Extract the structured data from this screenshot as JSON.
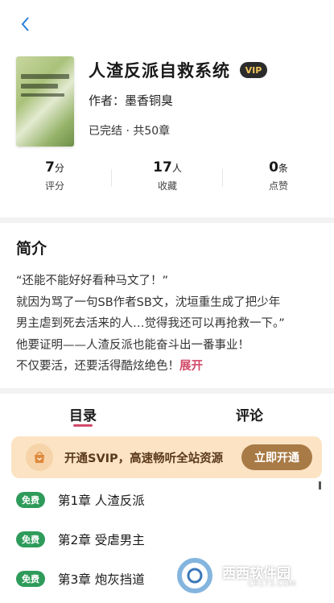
{
  "header": {
    "back_icon": "chevron-left-icon"
  },
  "book": {
    "title": "人渣反派自救系统",
    "vip_badge": "VIP",
    "author": "作者：墨香铜臭",
    "status": "已完结 · 共50章"
  },
  "stats": [
    {
      "value": "7",
      "unit": "分",
      "label": "评分"
    },
    {
      "value": "17",
      "unit": "人",
      "label": "收藏"
    },
    {
      "value": "0",
      "unit": "条",
      "label": "点赞"
    }
  ],
  "intro": {
    "title": "简介",
    "lines": [
      "“还能不能好好看种马文了！”",
      "就因为骂了一句SB作者SB文，沈垣重生成了把少年",
      "男主虐到死去活来的人…觉得我还可以再抢救一下。”",
      "他要证明——人渣反派也能奋斗出一番事业！",
      "不仅要活，还要活得酷炫绝色！"
    ],
    "expand": "展开"
  },
  "tabs": [
    {
      "label": "目录",
      "active": true
    },
    {
      "label": "评论",
      "active": false
    }
  ],
  "svip_banner": {
    "icon": "gift-bag-icon",
    "text": "开通SVIP，高速畅听全站资源",
    "button": "立即开通"
  },
  "chapters": [
    {
      "badge": "免费",
      "title": "第1章 人渣反派"
    },
    {
      "badge": "免费",
      "title": "第2章 受虐男主"
    },
    {
      "badge": "免费",
      "title": "第3章 炮灰挡道"
    }
  ],
  "watermark": {
    "text": "西西软件园",
    "url": "CR173.COM"
  },
  "colors": {
    "accent": "#d24a6a",
    "free_badge": "#2e9b5a",
    "svip_bg": "#fbe3c4",
    "svip_button": "#a87a45",
    "back": "#2a7fd6"
  }
}
